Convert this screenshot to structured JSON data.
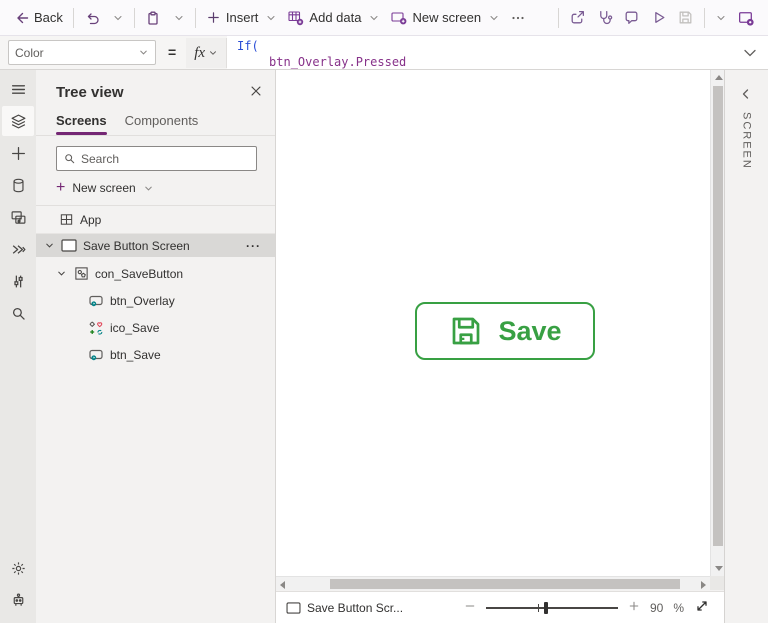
{
  "toolbar": {
    "back_label": "Back",
    "insert_label": "Insert",
    "add_data_label": "Add data",
    "new_screen_label": "New screen"
  },
  "formula_bar": {
    "property_selected": "Color",
    "equals": "=",
    "fx_label": "fx",
    "formula_line1": "If(",
    "formula_line2": "btn_Overlay.Pressed"
  },
  "tree_view": {
    "title": "Tree view",
    "tabs": [
      {
        "label": "Screens",
        "active": true
      },
      {
        "label": "Components",
        "active": false
      }
    ],
    "search_placeholder": "Search",
    "new_screen_label": "New screen",
    "app_label": "App",
    "screen_row": {
      "label": "Save Button Screen"
    },
    "children": [
      {
        "label": "con_SaveButton"
      },
      {
        "label": "btn_Overlay"
      },
      {
        "label": "ico_Save"
      },
      {
        "label": "btn_Save"
      }
    ]
  },
  "canvas": {
    "save_button_label": "Save"
  },
  "right_panel": {
    "label": "SCREEN"
  },
  "status_bar": {
    "screen_name": "Save Button Scr...",
    "zoom_value": "90",
    "zoom_unit": "%"
  },
  "icons": {
    "more_dots": "···"
  },
  "colors": {
    "accent_purple": "#742774",
    "button_green": "#38A043",
    "formula_function_blue": "#2b4fd6",
    "formula_reference_purple": "#87328a",
    "teal_control": "#038387"
  }
}
